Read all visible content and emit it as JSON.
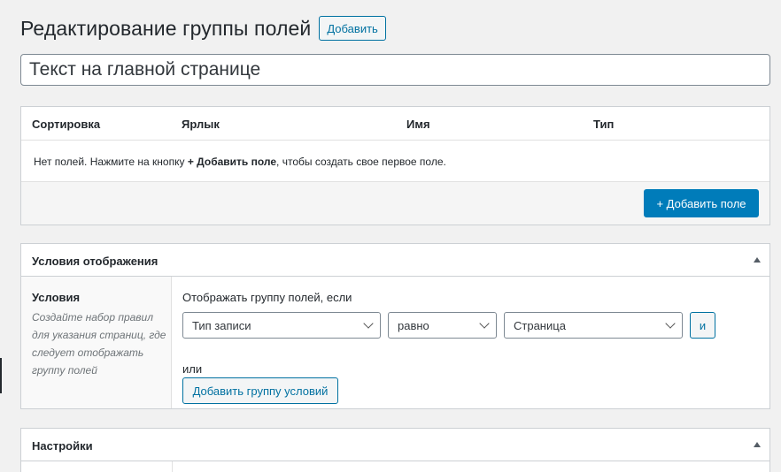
{
  "header": {
    "title": "Редактирование группы полей",
    "add_button": "Добавить"
  },
  "title_input": {
    "value": "Текст на главной странице"
  },
  "fields_table": {
    "columns": [
      "Сортировка",
      "Ярлык",
      "Имя",
      "Тип"
    ],
    "empty_prefix": "Нет полей. Нажмите на кнопку ",
    "empty_action": "+ Добавить поле",
    "empty_suffix": ", чтобы создать свое первое поле.",
    "add_field_button": "+ Добавить поле"
  },
  "location": {
    "title": "Условия отображения",
    "label": "Условия",
    "description": "Создайте набор правил для указания страниц, где следует отображать группу полей",
    "rule_heading": "Отображать группу полей, если",
    "param": "Тип записи",
    "operator": "равно",
    "value": "Страница",
    "and_button": "и",
    "or_label": "или",
    "add_group_button": "Добавить группу условий"
  },
  "settings": {
    "title": "Настройки"
  },
  "colors": {
    "primary": "#007cba",
    "outline": "#0071a1",
    "background": "#f1f1f1"
  }
}
